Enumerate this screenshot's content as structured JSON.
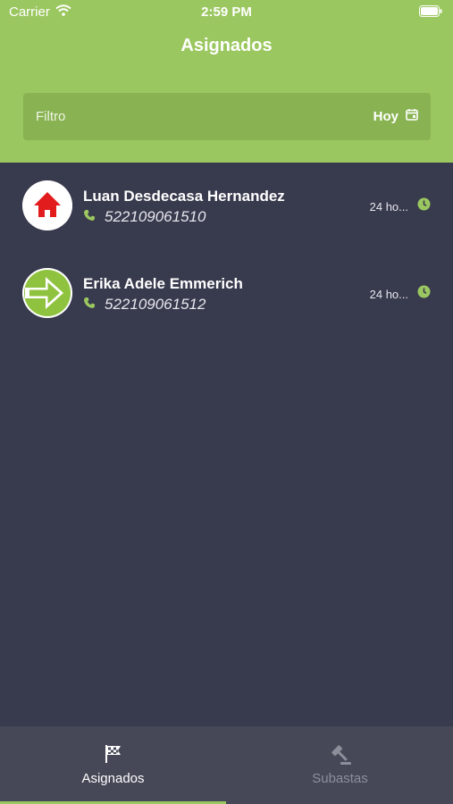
{
  "status_bar": {
    "carrier": "Carrier",
    "time": "2:59 PM"
  },
  "nav": {
    "title": "Asignados"
  },
  "filter": {
    "label": "Filtro",
    "date_value": "Hoy"
  },
  "items": [
    {
      "name": "Luan Desdecasa Hernandez",
      "phone": "522109061510",
      "time": "24 ho...",
      "avatar_icon": "home-icon"
    },
    {
      "name": "Erika Adele Emmerich",
      "phone": "522109061512",
      "time": "24 ho...",
      "avatar_icon": "arrow-right-icon"
    }
  ],
  "tabs": [
    {
      "label": "Asignados",
      "icon": "checkered-flag-icon",
      "active": true
    },
    {
      "label": "Subastas",
      "icon": "gavel-icon",
      "active": false
    }
  ],
  "colors": {
    "accent": "#9bc760",
    "background": "#383a4d",
    "filter_bg": "#89b352",
    "tabbar": "#464857",
    "home_red": "#e21c1c"
  }
}
